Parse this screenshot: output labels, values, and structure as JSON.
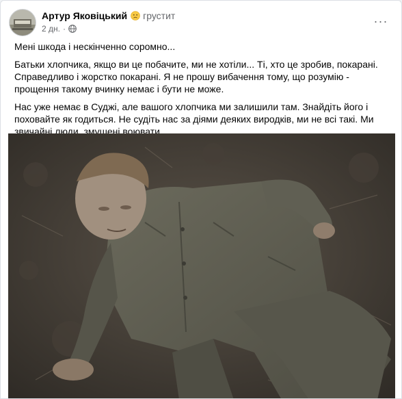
{
  "post": {
    "author": "Артур Яковіцький",
    "feeling_emoji": "sad-face-emoji",
    "feeling": "грустит",
    "time": "2 дн.",
    "separator": "·",
    "privacy_icon": "globe-icon",
    "more_icon": "more-options-icon",
    "more_label": "···",
    "paragraphs": [
      "Мені шкода і нескінченно соромно...",
      "Батьки хлопчика, якщо ви це побачите, ми не хотіли... Ті, хто це зробив, покарані. Справедливо і жорстко покарані. Я не прошу вибачення тому, що розумію - прощення такому вчинку немає і бути не може.",
      "Нас уже немає в Суджі, але вашого хлопчика ми залишили там. Знайдіть його і поховайте як годиться. Не судіть нас за діями деяких виродків, ми не всі такі. Ми звичайні люди, змушені воювати"
    ]
  },
  "colors": {
    "name": "#050505",
    "secondary": "#65676b",
    "card_bg": "#ffffff",
    "page_bg": "#f0f2f5"
  }
}
